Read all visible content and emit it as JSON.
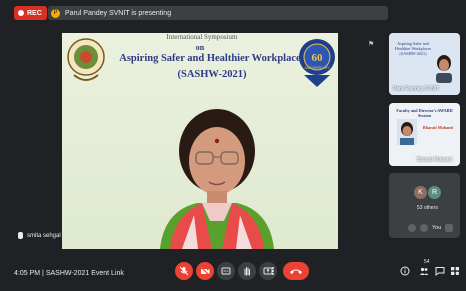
{
  "topbar": {
    "rec_label": "REC",
    "presenting_text": "Parul Pandey SVNIT is presenting",
    "present_icon": "P"
  },
  "stage": {
    "banner_top": "International Symposium",
    "banner_on": "on",
    "banner_title_line1": "Aspiring Safer and Healthier Workplaces",
    "banner_title_line2": "(SASHW-2021)",
    "emblem_right_number": "60",
    "emblem_right_word": "ANNIVERSARY",
    "speaker_name": "smita sehgal"
  },
  "sidebar": {
    "tile1_text": "Aspiring Safer and Healthier Workplaces (SASHW-2021)",
    "tile1_label": "Parul Pandey SVNIT",
    "tile2_header": "Faculty and Director's AWARD Session",
    "tile2_name": "Bharati Mohanti",
    "tile2_label": "Bharati Mohanti",
    "avatars": [
      "K",
      "R"
    ],
    "others_label": "53 others",
    "you_label": "You"
  },
  "bottom": {
    "time": "4:05 PM",
    "separator": "|",
    "meeting_name": "SASHW-2021 Event Link",
    "participant_count": "54"
  },
  "colors": {
    "rec": "#d93025",
    "end_call": "#ea4335",
    "banner_text": "#2e3a87",
    "background": "#202124"
  },
  "icons": [
    "pin-icon",
    "mic-off-icon",
    "camera-off-icon",
    "captions-icon",
    "raise-hand-icon",
    "present-icon",
    "more-icon",
    "hangup-icon",
    "info-icon",
    "people-icon",
    "chat-icon",
    "activities-icon"
  ]
}
